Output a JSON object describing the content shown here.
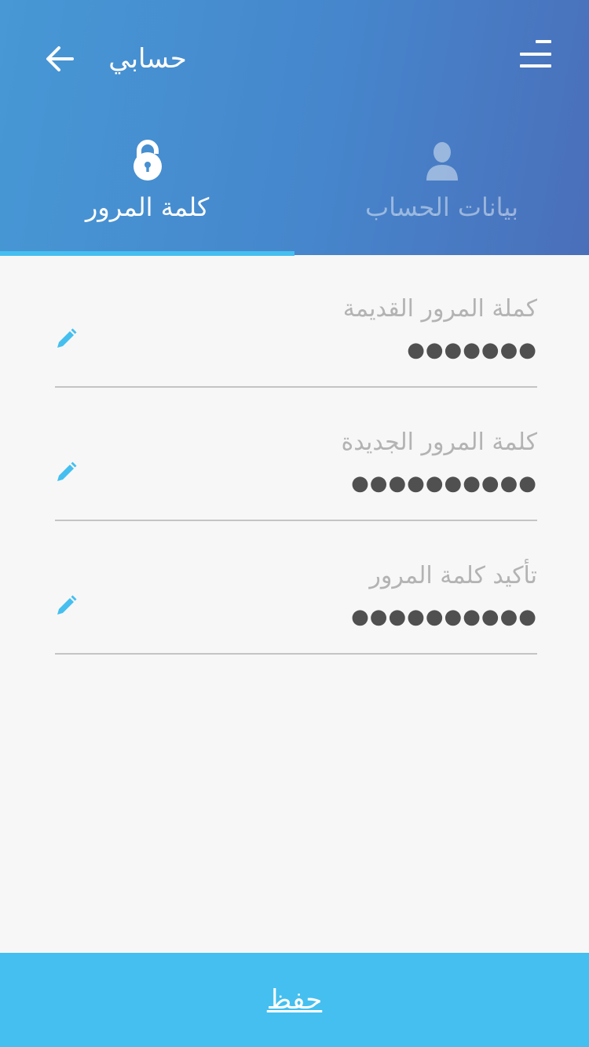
{
  "header": {
    "title": "حسابي",
    "back_icon": "arrow-left-icon",
    "menu_icon": "menu-icon"
  },
  "tabs": [
    {
      "label": "كلمة المرور",
      "icon": "lock-icon",
      "active": true
    },
    {
      "label": "بيانات الحساب",
      "icon": "user-icon",
      "active": false
    }
  ],
  "fields": [
    {
      "label": "كملة المرور القديمة",
      "value": "●●●●●●●",
      "icon": "pencil-icon"
    },
    {
      "label": "كلمة المرور الجديدة",
      "value": "●●●●●●●●●●",
      "icon": "pencil-icon"
    },
    {
      "label": "تأكيد كلمة المرور",
      "value": "●●●●●●●●●●",
      "icon": "pencil-icon"
    }
  ],
  "save_button": {
    "label": "حفظ"
  },
  "colors": {
    "header_start": "#4798d5",
    "header_end": "#4a6fba",
    "accent": "#45bfef",
    "background": "#f7f7f7"
  }
}
